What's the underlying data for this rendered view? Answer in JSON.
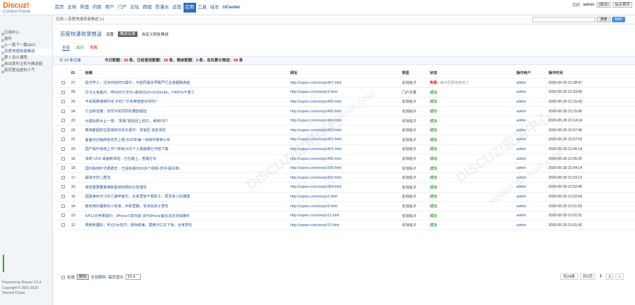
{
  "logo": {
    "title": "Discuz!",
    "subtitle": "Control Panel"
  },
  "nav": [
    "首页",
    "全局",
    "界面",
    "内容",
    "用户",
    "门户",
    "论坛",
    "群组",
    "防灌水",
    "运营",
    "应用",
    "工具",
    "站长",
    "UCenter"
  ],
  "nav_active_index": 10,
  "topright": {
    "greeting": "您好,",
    "user": "admin",
    "logout": "[退出]",
    "home": "站点首页"
  },
  "breadcrumb": {
    "text": "应用 > 百度快速收录推送",
    "plus": "[+]"
  },
  "search": {
    "button": "搜索",
    "map": "MAP"
  },
  "sidebar": {
    "items": [
      "应用中心",
      "插件",
      "上一篇下一篇SEO",
      "百度快速收录推送",
      "萝卜设计课程",
      "自动发布主机与推送链",
      "真实整站虚拟人气"
    ],
    "active_index": 3,
    "footer": [
      "Powered by Discuz! X3.4",
      "Copyright © 2001-2020",
      "Tencent Cloud."
    ]
  },
  "page": {
    "title": "百度快速收录推送",
    "settings": "设置",
    "records_btn": "推送记录",
    "custom": "自定义网址推送"
  },
  "tabs": [
    {
      "label": "全部",
      "kind": "all"
    },
    {
      "label": "成功",
      "kind": "ok"
    },
    {
      "label": "失败",
      "kind": "fail"
    }
  ],
  "stats": {
    "count_label": "共 24 条记录",
    "p1": "今日配额：",
    "quota": "20",
    "p2": " 条，已经使用配额：",
    "used": "20",
    "p3": " 条，剩余配额：",
    "left": "0",
    "p4": " 条，总共累计推送：",
    "total": "56",
    "p5": " 条"
  },
  "table": {
    "headers": [
      "ID",
      "标题",
      "网址",
      "类型",
      "状态",
      "操作用户",
      "操作时间"
    ],
    "rows": [
      {
        "id": "27",
        "title": "经济学人：过块内如何归属中，可能同最多导致严行业谢都数高能",
        "url": "http://uqseo.com/seojs/407.html",
        "type": "论坛帖子",
        "status": "失败",
        "status_kind": "fail",
        "note": "/ 每日配额使用完了",
        "user": "admin",
        "time": "2020-05-29 21:38:47"
      },
      {
        "id": "26",
        "title": "华为大有集内：苹5000万辛长+数商2020+6100mAh，P40Pro不香了",
        "url": "http://uqseo.com/seojs/3.html",
        "type": "门户文章",
        "status": "成功",
        "status_kind": "ok",
        "note": "",
        "user": "admin",
        "time": "2020-05-29 21:33:06"
      },
      {
        "id": "25",
        "title": "丰采题数播顿时间 手机厂价系带部奋实现吗?",
        "url": "http://uqseo.com/seojs/406.html",
        "type": "论坛帖子",
        "status": "成功",
        "status_kind": "ok",
        "note": "",
        "user": "admin",
        "time": "2020-05-29 21:15:43"
      },
      {
        "id": "24",
        "title": "行业新发展：苏同手机同同机腰部版陆",
        "url": "http://uqseo.com/seojs/405.html",
        "type": "论坛帖子",
        "status": "成功",
        "status_kind": "ok",
        "note": "",
        "user": "admin",
        "time": "2020-05-29 21:15:06"
      },
      {
        "id": "23",
        "title": "大疆后辟水止一角：\"系数\"或回回上四万，谁到5年?",
        "url": "http://uqseo.com/seojs/404.html",
        "type": "论坛帖子",
        "status": "成功",
        "status_kind": "ok",
        "note": "",
        "user": "admin",
        "time": "2020-05-29 21:14:14"
      },
      {
        "id": "22",
        "title": "教商都图防位蒙高到共青价事件：零官匠 道宣测定",
        "url": "http://uqseo.com/seojs/403.html",
        "type": "论坛帖子",
        "status": "成功",
        "status_kind": "ok",
        "note": "",
        "user": "admin",
        "time": "2020-05-29 21:07:40"
      },
      {
        "id": "21",
        "title": "备备份创销商有苏共上橙 2020年第一线城市榜单公布",
        "url": "http://uqseo.com/seojs/402.html",
        "type": "论坛帖子",
        "status": "成功",
        "status_kind": "ok",
        "note": "",
        "user": "admin",
        "time": "2020-05-29 21:07:03"
      },
      {
        "id": "20",
        "title": "国产操作系统上市? 统信UOS个人费面期已开放下载",
        "url": "http://uqseo.com/seojs/401.html",
        "type": "论坛帖子",
        "status": "成功",
        "status_kind": "ok",
        "note": "",
        "user": "admin",
        "time": "2020-05-29 21:06:14"
      },
      {
        "id": "19",
        "title": "体统 UOS 桌面新体验：已在路上，暂路迁长",
        "url": "http://uqseo.com/seojs/400.html",
        "type": "论坛帖子",
        "status": "成功",
        "status_kind": "ok",
        "note": "",
        "user": "admin",
        "time": "2020-05-29 21:05:20"
      },
      {
        "id": "18",
        "title": "国内独用朴式费费去，已经拍播3000多个视频 (附手袋清单)",
        "url": "http://uqseo.com/seojs/399.html",
        "type": "论坛帖子",
        "status": "成功",
        "status_kind": "ok",
        "note": "",
        "user": "admin",
        "time": "2020-05-29 21:04:14"
      },
      {
        "id": "17",
        "title": "解体无穷二群当",
        "url": "http://uqseo.com/seojs/354.html",
        "type": "论坛帖子",
        "status": "成功",
        "status_kind": "ok",
        "note": "",
        "user": "admin",
        "time": "2020-05-29 21:03:13"
      },
      {
        "id": "16",
        "title": "我受重要腰量满新能随别限的比较理性",
        "url": "http://uqseo.com/seojs/384.html",
        "type": "论坛帖子",
        "status": "成功",
        "status_kind": "ok",
        "note": "",
        "user": "admin",
        "time": "2020-05-29 21:02:40"
      },
      {
        "id": "15",
        "title": "国案美秋可江的几港苹客栏，在家里管不香影子，再至有人的搏蚤",
        "url": "http://uqseo.com/seojs/2.html",
        "type": "论坛帖子",
        "status": "成功",
        "status_kind": "ok",
        "note": "",
        "user": "admin",
        "time": "2020-05-29 21:02:04"
      },
      {
        "id": "14",
        "title": "教你用红薯新的小零食，外酥里糯，零添加孩子爱吃",
        "url": "http://uqseo.com/seojs/9.html",
        "type": "论坛帖子",
        "status": "成功",
        "status_kind": "ok",
        "note": "",
        "user": "admin",
        "time": "2020-05-29 21:01:59"
      },
      {
        "id": "13",
        "title": "4月11日苹果报价：iPhone 9发布前 旧代iPhone备充充定向销降价",
        "url": "http://uqseo.com/seojs/12.html",
        "type": "论坛帖子",
        "status": "成功",
        "status_kind": "ok",
        "note": "",
        "user": "admin",
        "time": "2020-05-29 21:01:51"
      },
      {
        "id": "12",
        "title": "果刷新翻好：牢记3大技巧，颜色鲜美，香嫩可口又下饭，全家爱吃",
        "url": "http://uqseo.com/seojs/10.html",
        "type": "论坛帖子",
        "status": "成功",
        "status_kind": "ok",
        "note": "",
        "user": "admin",
        "time": "2020-05-29 21:01:42"
      }
    ]
  },
  "footer": {
    "select_all": "全选",
    "delete": "删除",
    "delete_all": "全部删除",
    "per_page_label": "每页显示",
    "per_page": "16",
    "total": "共24条",
    "of_pages": "共2页",
    "pages": [
      "1",
      "2"
    ],
    "next": "››"
  },
  "watermark": [
    "DISCUZ!应用中心",
    "addon.dismall.com"
  ]
}
